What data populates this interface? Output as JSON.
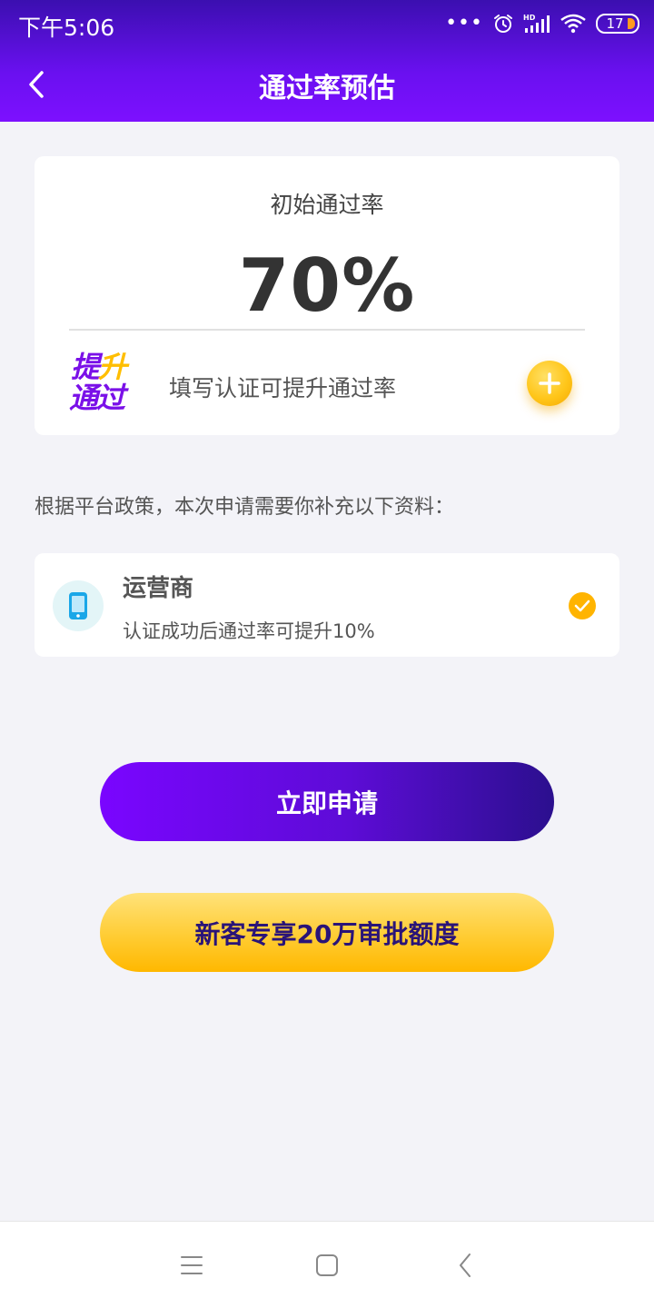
{
  "status_bar": {
    "time": "下午5:06",
    "dots": "•••",
    "battery": "17"
  },
  "header": {
    "title": "通过率预估"
  },
  "rate_card": {
    "label": "初始通过率",
    "value": "70%",
    "boost_logo_line1": "提升",
    "boost_logo_line2": "通过",
    "boost_text": "填写认证可提升通过率"
  },
  "notice": "根据平台政策，本次申请需要你补充以下资料：",
  "items": [
    {
      "title": "运营商",
      "desc": "认证成功后通过率可提升10%",
      "checked": true
    }
  ],
  "buttons": {
    "apply": "立即申请",
    "promo": "新客专享20万审批额度"
  },
  "colors": {
    "header_start": "#3b0fb0",
    "header_end": "#7d10ff",
    "accent_yellow": "#ffc61a",
    "check_yellow": "#ffb400"
  }
}
